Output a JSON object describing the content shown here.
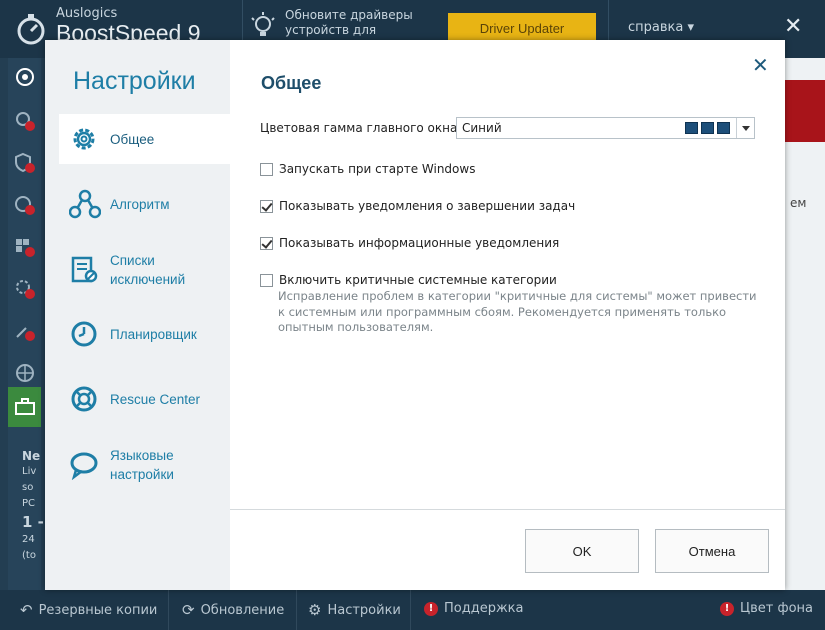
{
  "app": {
    "brand_small": "Auslogics",
    "brand_big": "BoostSpeed 9",
    "driver_promo": "Обновите драйверы устройств для",
    "driver_updater_label": "Driver Updater",
    "help_menu": "справка ▾",
    "close_glyph": "✕",
    "right_partial_text": "ем",
    "news_lines": [
      "Ne",
      "Liv",
      "so",
      "PC",
      "1 -",
      "",
      "24",
      "(to"
    ]
  },
  "footer": {
    "backups": "Резервные копии",
    "update": "Обновление",
    "settings": "Настройки",
    "support": "Поддержка",
    "bg_color": "Цвет фона",
    "alert_glyph": "!"
  },
  "modal": {
    "nav_title": "Настройки",
    "nav_items": [
      {
        "label": "Общее",
        "icon": "gear-icon"
      },
      {
        "label": "Алгоритм",
        "icon": "algorithm-icon"
      },
      {
        "label": "Списки исключений",
        "icon": "exclusion-list-icon"
      },
      {
        "label": "Планировщик",
        "icon": "clock-icon"
      },
      {
        "label": "Rescue Center",
        "icon": "lifebuoy-icon"
      },
      {
        "label": "Языковые настройки",
        "icon": "speech-bubble-icon"
      }
    ],
    "content_title": "Общее",
    "close_glyph": "✕",
    "color_scheme": {
      "label": "Цветовая гамма главного окна:",
      "value": "Синий",
      "swatch_color": "#1d4f7a"
    },
    "options": [
      {
        "label": "Запускать при старте Windows",
        "checked": false
      },
      {
        "label": "Показывать уведомления о завершении задач",
        "checked": true
      },
      {
        "label": "Показывать информационные уведомления",
        "checked": true
      },
      {
        "label": "Включить критичные системные категории",
        "checked": false
      }
    ],
    "critical_description": "Исправление проблем в категории \"критичные для системы\" может привести к системным или программным сбоям. Рекомендуется применять только опытным пользователям.",
    "ok_label": "OK",
    "cancel_label": "Отмена"
  },
  "colors": {
    "accent": "#1e7ea6",
    "driver_button": "#e8b414",
    "alert_red": "#c8232b"
  }
}
